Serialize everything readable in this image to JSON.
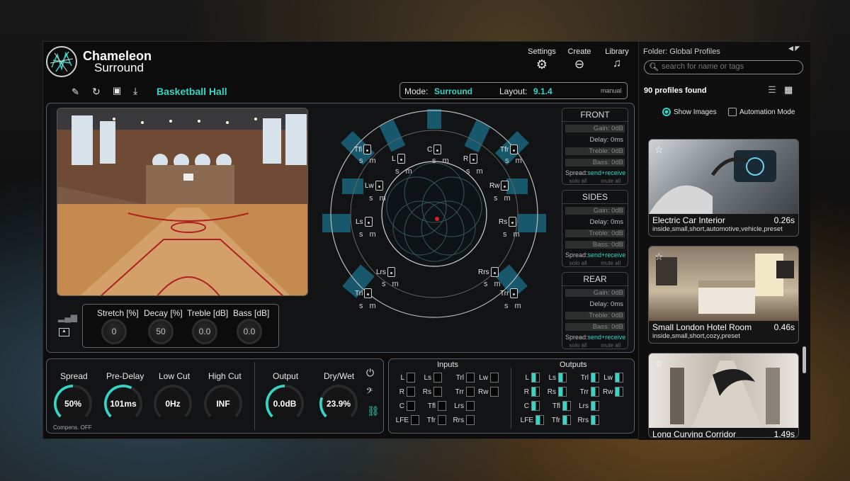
{
  "brand": {
    "name": "Chameleon",
    "sub": "Surround"
  },
  "menu": {
    "settings": "Settings",
    "create": "Create",
    "library": "Library"
  },
  "toolbar": {
    "preset_name": "Basketball Hall",
    "mode_label": "Mode:",
    "mode_value": "Surround",
    "layout_label": "Layout:",
    "layout_value": "9.1.4",
    "manual": "manual"
  },
  "params": [
    {
      "label": "Stretch [%]",
      "value": "0"
    },
    {
      "label": "Decay [%]",
      "value": "50"
    },
    {
      "label": "Treble [dB]",
      "value": "0.0"
    },
    {
      "label": "Bass [dB]",
      "value": "0.0"
    }
  ],
  "speakers": {
    "tfl": "Tfl",
    "l": "L",
    "c": "C",
    "r": "R",
    "tfr": "Tfr",
    "lw": "Lw",
    "rw": "Rw",
    "ls": "Ls",
    "rs": "Rs",
    "lrs": "Lrs",
    "rrs": "Rrs",
    "trl": "Trl",
    "trr": "Trr",
    "sm": "s m"
  },
  "sections": [
    {
      "title": "FRONT",
      "gain": "Gain: 0dB",
      "delay": "Delay: 0ms",
      "treble": "Treble: 0dB",
      "bass": "Bass: 0dB",
      "spread_label": "Spread:",
      "spread_value": "send+receive",
      "solo": "solo all",
      "mute": "mute all"
    },
    {
      "title": "SIDES",
      "gain": "Gain: 0dB",
      "delay": "Delay: 0ms",
      "treble": "Treble: 0dB",
      "bass": "Bass: 0dB",
      "spread_label": "Spread:",
      "spread_value": "send+receive",
      "solo": "solo all",
      "mute": "mute all"
    },
    {
      "title": "REAR",
      "gain": "Gain: 0dB",
      "delay": "Delay: 0ms",
      "treble": "Treble: 0dB",
      "bass": "Bass: 0dB",
      "spread_label": "Spread:",
      "spread_value": "send+receive",
      "solo": "solo all",
      "mute": "mute all"
    }
  ],
  "bottom": {
    "spread": {
      "label": "Spread",
      "value": "50%",
      "level": 0.5
    },
    "predelay": {
      "label": "Pre-Delay",
      "value": "101ms",
      "level": 0.6
    },
    "lowcut": {
      "label": "Low Cut",
      "value": "0Hz",
      "level": 0
    },
    "highcut": {
      "label": "High Cut",
      "value": "INF",
      "level": 0
    },
    "compens": "Compens. OFF",
    "output": {
      "label": "Output",
      "value": "0.0dB",
      "level": 0.5
    },
    "drywet": {
      "label": "Dry/Wet",
      "value": "23.9%",
      "level": 0.24
    }
  },
  "io": {
    "inputs": "Inputs",
    "outputs": "Outputs",
    "channels": [
      [
        "L",
        "Ls",
        "Trl",
        "Lw"
      ],
      [
        "R",
        "Rs",
        "Trr",
        "Rw"
      ],
      [
        "C",
        "Tfl",
        "Lrs"
      ],
      [
        "LFE",
        "Tfr",
        "Rrs"
      ]
    ]
  },
  "library": {
    "folder": "Folder: Global Profiles",
    "search_placeholder": "search for name or tags",
    "count": "90 profiles found",
    "show_images": "Show Images",
    "automation": "Automation Mode",
    "profiles": [
      {
        "name": "Electric Car Interior",
        "time": "0.26s",
        "tags": "inside,small,short,automotive,vehicle,preset"
      },
      {
        "name": "Small London Hotel Room",
        "time": "0.46s",
        "tags": "inside,small,short,cozy,preset"
      },
      {
        "name": "Long Curving Corridor",
        "time": "1.49s",
        "tags": ""
      }
    ]
  },
  "colors": {
    "accent": "#35d6c8",
    "background": "#0c0c0c"
  }
}
